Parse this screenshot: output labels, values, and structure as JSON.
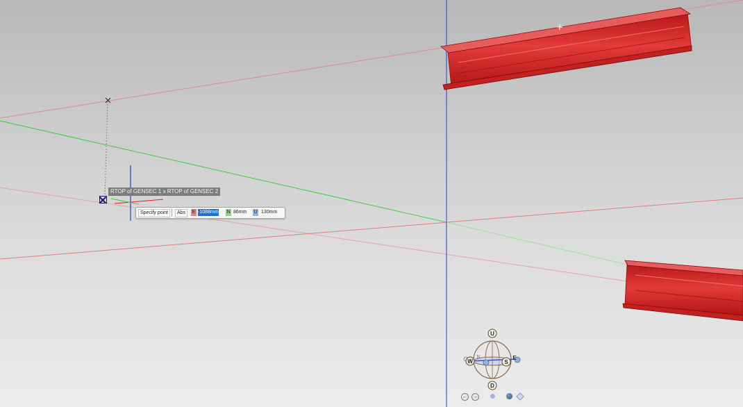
{
  "snap_label": "RTOP of GENSEC 1 x RTOP of GENSEC 2",
  "input_bar": {
    "prompt_button": "Specify point",
    "mode_button": "Abs",
    "east_tag": "E",
    "east_value": "-1088mm",
    "north_tag": "N",
    "north_value": "86mm",
    "up_tag": "U",
    "up_value": "130mm"
  },
  "compass": {
    "up": "U",
    "down": "D",
    "west": "W",
    "south": "S",
    "east": "E",
    "north": "N"
  },
  "nav": {
    "back": "←",
    "forward": "→"
  },
  "colors": {
    "beam_red": "#d92424",
    "x_axis_red": "#e05050",
    "y_axis_green": "#3ccf3c",
    "z_axis_blue": "#2a3ae0",
    "selection_blue": "#1e6fd0"
  }
}
